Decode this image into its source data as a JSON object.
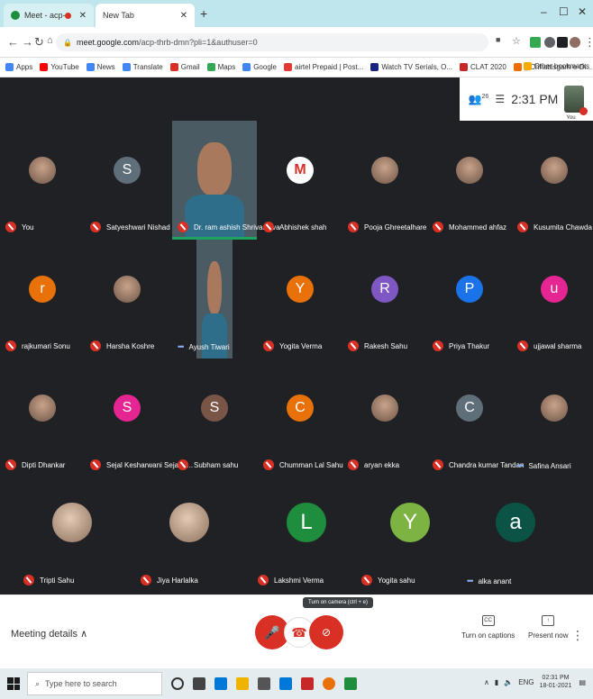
{
  "browser": {
    "tabs": [
      {
        "label": "Meet - acp-thrb-dmn",
        "icon_color": "#1e8e3e"
      },
      {
        "label": "New Tab",
        "icon_color": "#9aa0a6"
      }
    ],
    "new_tab_symbol": "+",
    "window_controls": [
      "–",
      "☐",
      "✕"
    ],
    "url_host": "meet.google.com",
    "url_path": "/acp-thrb-dmn?pli=1&authuser=0",
    "bookmarks": [
      {
        "label": "Apps",
        "color": "#4285f4"
      },
      {
        "label": "YouTube",
        "color": "#ff0000"
      },
      {
        "label": "News",
        "color": "#4285f4"
      },
      {
        "label": "Translate",
        "color": "#4285f4"
      },
      {
        "label": "Gmail",
        "color": "#d93025"
      },
      {
        "label": "Maps",
        "color": "#34a853"
      },
      {
        "label": "Google",
        "color": "#4285f4"
      },
      {
        "label": "airtel Prepaid | Post...",
        "color": "#e53935"
      },
      {
        "label": "Watch TV Serials, O...",
        "color": "#1a237e"
      },
      {
        "label": "CLAT 2020",
        "color": "#c62828"
      },
      {
        "label": "|| Chhattisgarh e-Di...",
        "color": "#ef6c00"
      }
    ],
    "other_bookmarks": "Other bookmarks"
  },
  "meet": {
    "people_count": "26",
    "clock": "2:31 PM",
    "self_label": "You",
    "participants": [
      {
        "name": "You",
        "avatar": "photo",
        "muted": true
      },
      {
        "name": "Satyeshwari Nishad",
        "letter": "S",
        "color": "#5f6f7a",
        "muted": true
      },
      {
        "name": "Dr. ram ashish Shrivastava",
        "avatar": "video",
        "muted": true,
        "speaking": true
      },
      {
        "name": "Abhishek shah",
        "avatar": "gmail",
        "muted": true
      },
      {
        "name": "Pooja Ghreetalhare",
        "avatar": "photo",
        "muted": true
      },
      {
        "name": "Mohammed ahfaz",
        "avatar": "photo",
        "muted": true
      },
      {
        "name": "Kusumita Chawda",
        "avatar": "photo",
        "muted": true
      },
      {
        "name": "rajkumari Sonu",
        "letter": "r",
        "color": "#e8710a",
        "muted": true
      },
      {
        "name": "Harsha Koshre",
        "avatar": "photo",
        "muted": true
      },
      {
        "name": "Ayush Tiwari",
        "avatar": "video",
        "muted": false
      },
      {
        "name": "Yogita Verma",
        "letter": "Y",
        "color": "#e8710a",
        "muted": true
      },
      {
        "name": "Rakesh Sahu",
        "letter": "R",
        "color": "#7e57c2",
        "muted": true
      },
      {
        "name": "Priya Thakur",
        "letter": "P",
        "color": "#1a73e8",
        "muted": true
      },
      {
        "name": "ujjawal sharma",
        "letter": "u",
        "color": "#e52592",
        "muted": true
      },
      {
        "name": "Dipti Dhankar",
        "avatar": "photo",
        "muted": true
      },
      {
        "name": "Sejal Kesharwani Sejal K...",
        "letter": "S",
        "color": "#e52592",
        "muted": true
      },
      {
        "name": "Subham sahu",
        "letter": "S",
        "color": "#795548",
        "muted": true
      },
      {
        "name": "Chumman Lal Sahu",
        "letter": "C",
        "color": "#e8710a",
        "muted": true
      },
      {
        "name": "aryan ekka",
        "avatar": "photo",
        "muted": true
      },
      {
        "name": "Chandra kumar Tandan",
        "letter": "C",
        "color": "#5f6f7a",
        "muted": true
      },
      {
        "name": "Safina Ansari",
        "avatar": "photo",
        "muted": false
      }
    ],
    "bottom_row": [
      {
        "name": "Tripti Sahu",
        "avatar": "photo",
        "muted": true
      },
      {
        "name": "Jiya Harlalka",
        "avatar": "photo",
        "muted": true
      },
      {
        "name": "Lakshmi Verma",
        "letter": "L",
        "color": "#1e8e3e",
        "muted": true
      },
      {
        "name": "Yogita sahu",
        "letter": "Y",
        "color": "#7cb342",
        "muted": true
      },
      {
        "name": "alka anant",
        "letter": "a",
        "color": "#0b5345",
        "muted": false
      }
    ],
    "meeting_details": "Meeting details",
    "tooltip": "Turn on camera (ctrl + e)",
    "captions_label": "Turn on captions",
    "present_label": "Present now"
  },
  "taskbar": {
    "search_placeholder": "Type here to search",
    "time": "02:31 PM",
    "date": "18-01-2021",
    "lang": "ENG"
  }
}
